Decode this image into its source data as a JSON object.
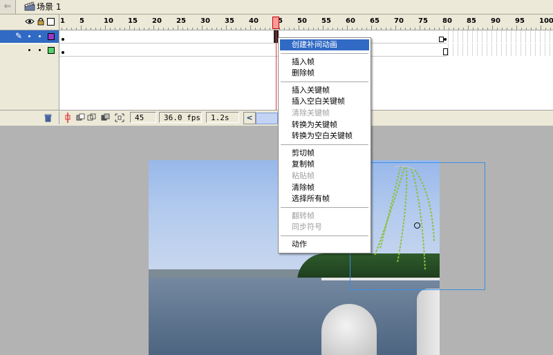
{
  "scene_bar": {
    "back_label": "⇐",
    "scene_label": "场景 1"
  },
  "timeline": {
    "ruler_ticks": [
      "1",
      "5",
      "10",
      "15",
      "20",
      "25",
      "30",
      "35",
      "40",
      "45",
      "50",
      "55",
      "60",
      "65",
      "70",
      "75",
      "80",
      "85",
      "90",
      "95",
      "100"
    ],
    "header_icons": [
      "eye-icon",
      "lock-icon",
      "outline-icon"
    ],
    "layers": [
      {
        "pencil": "✎",
        "color": "#9c36c8",
        "selected": true
      },
      {
        "pencil": "",
        "color": "#55d26d",
        "selected": false
      }
    ],
    "current_frame": "45",
    "frame_rate": "36.0 fps",
    "elapsed_time": "1.2s",
    "scroll_left": "<"
  },
  "context_menu": {
    "items": [
      {
        "label": "创建补间动画",
        "disabled": false,
        "highlight": true
      },
      {
        "sep": true
      },
      {
        "label": "插入帧",
        "disabled": false
      },
      {
        "label": "删除帧",
        "disabled": false
      },
      {
        "sep": true
      },
      {
        "label": "插入关键帧",
        "disabled": false
      },
      {
        "label": "插入空白关键帧",
        "disabled": false
      },
      {
        "label": "清除关键帧",
        "disabled": true
      },
      {
        "label": "转换为关键帧",
        "disabled": false
      },
      {
        "label": "转换为空白关键帧",
        "disabled": false
      },
      {
        "sep": true
      },
      {
        "label": "剪切帧",
        "disabled": false
      },
      {
        "label": "复制帧",
        "disabled": false
      },
      {
        "label": "粘贴帧",
        "disabled": true
      },
      {
        "label": "清除帧",
        "disabled": false
      },
      {
        "label": "选择所有帧",
        "disabled": false
      },
      {
        "sep": true
      },
      {
        "label": "翻转帧",
        "disabled": true
      },
      {
        "label": "同步符号",
        "disabled": true
      },
      {
        "sep": true
      },
      {
        "label": "动作",
        "disabled": false
      }
    ]
  },
  "colors": {
    "selection": "#316ac5",
    "playhead": "#d33333",
    "chrome": "#ece9d8"
  }
}
